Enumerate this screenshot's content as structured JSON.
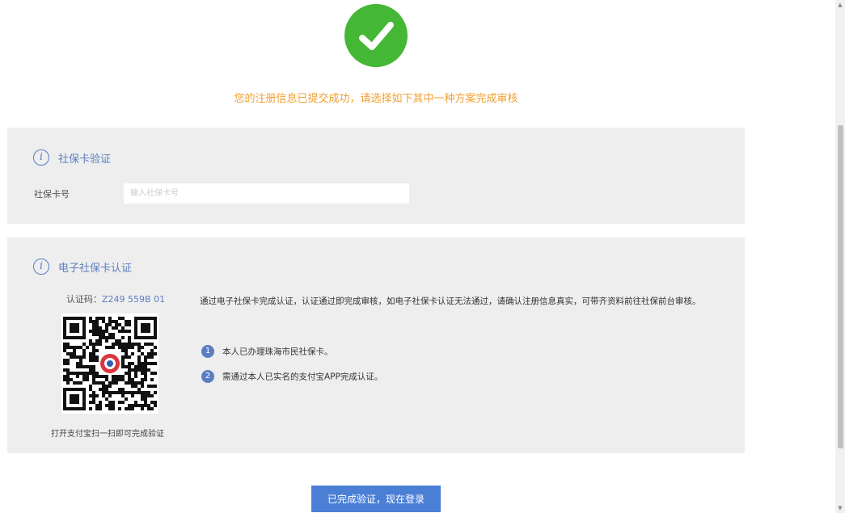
{
  "success": {
    "message": "您的注册信息已提交成功，请选择如下其中一种方案完成审核"
  },
  "social_card": {
    "title": "社保卡验证",
    "label": "社保卡号",
    "value": "",
    "placeholder": "输入社保卡号"
  },
  "e_social_card": {
    "title": "电子社保卡认证",
    "code_label": "认证码：",
    "code_value": "Z249 559B 01",
    "qr_caption": "打开支付宝扫一扫即可完成验证",
    "description": "通过电子社保卡完成认证，认证通过即完成审核，如电子社保卡认证无法通过，请确认注册信息真实，可带齐资料前往社保前台审核。",
    "steps": [
      {
        "num": "1",
        "text": "本人已办理珠海市民社保卡。"
      },
      {
        "num": "2",
        "text": "需通过本人已实名的支付宝APP完成认证。"
      }
    ]
  },
  "submit_label": "已完成验证，现在登录",
  "colors": {
    "success_green": "#44b734",
    "message_orange": "#f0a030",
    "accent_blue": "#5b7ec2",
    "button_blue": "#4b7fd6",
    "panel_gray": "#eeeeee"
  },
  "icons": {
    "success": "checkmark-icon",
    "info": "info-icon",
    "scroll_up": "scroll-up-arrow-icon",
    "scroll_down": "scroll-down-arrow-icon"
  }
}
